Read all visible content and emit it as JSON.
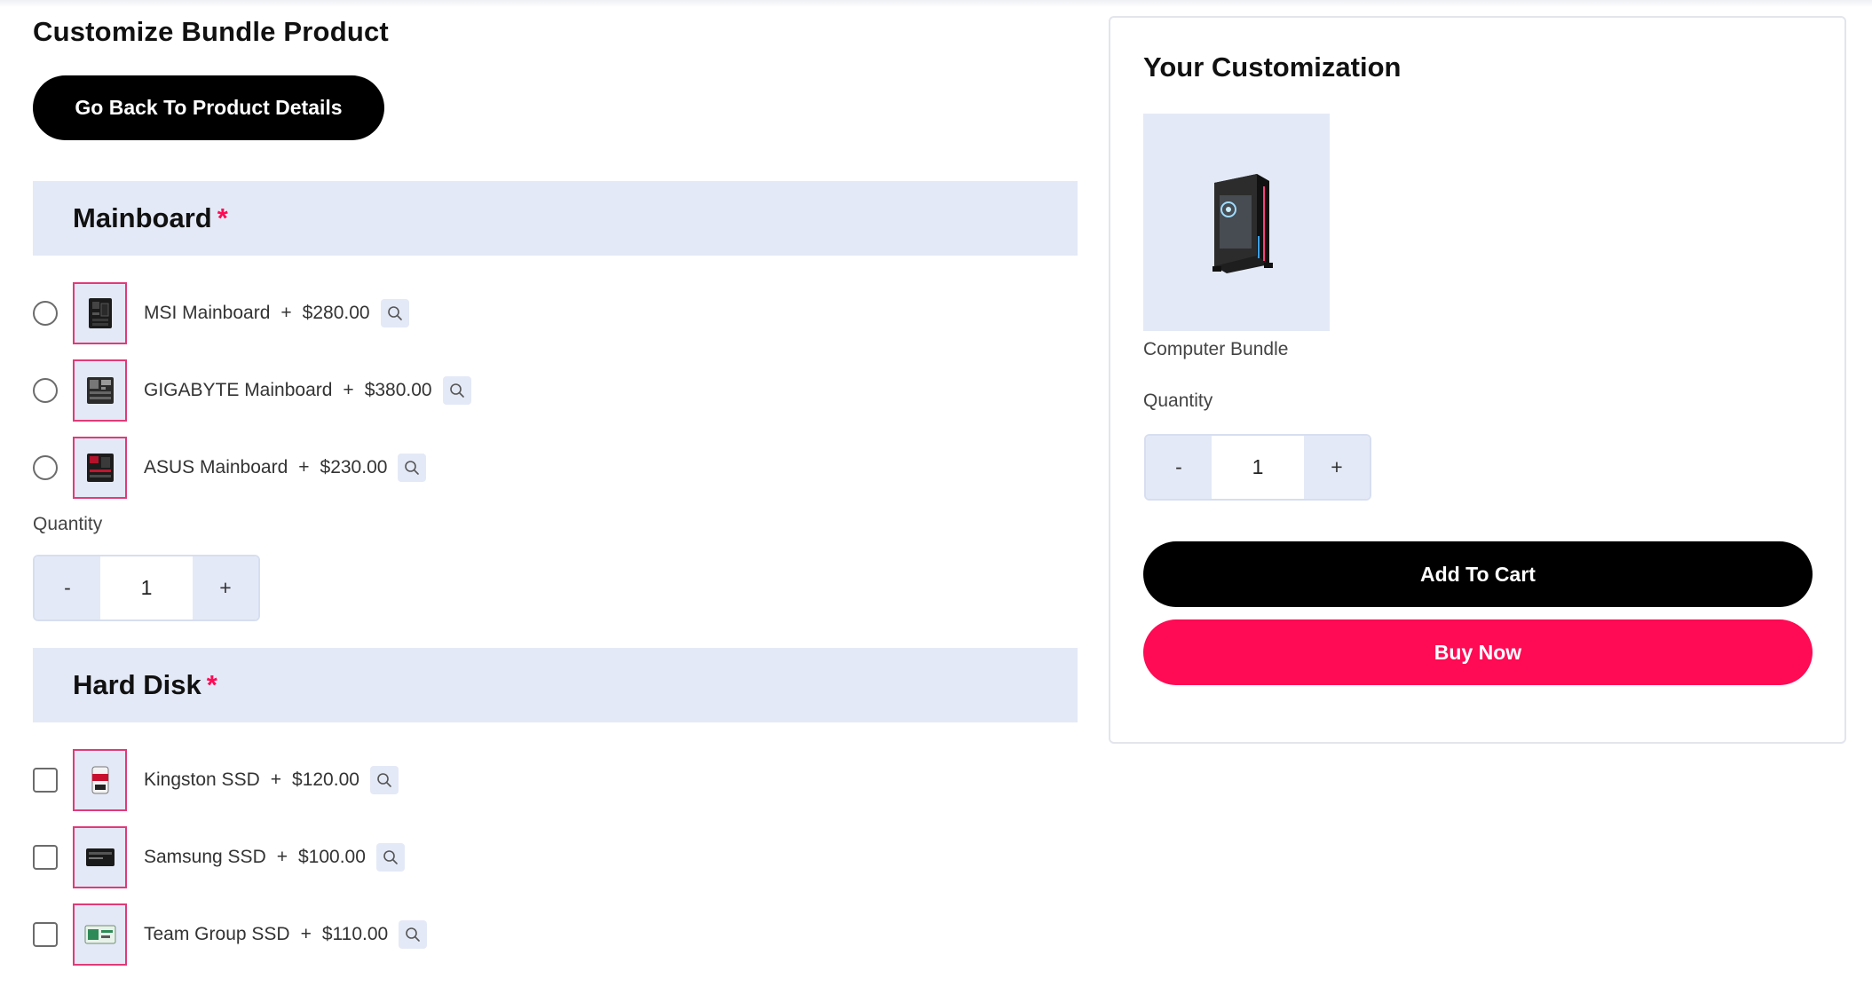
{
  "page": {
    "title": "Customize Bundle Product",
    "back_button": "Go Back To Product Details"
  },
  "mainboard": {
    "title": "Mainboard",
    "required_mark": "*",
    "input_type": "radio",
    "options": [
      {
        "name": "MSI Mainboard",
        "plus": "+",
        "price": "$280.00",
        "thumb_icon": "mainboard-thumb-icon"
      },
      {
        "name": "GIGABYTE Mainboard",
        "plus": "+",
        "price": "$380.00",
        "thumb_icon": "mainboard-thumb-icon"
      },
      {
        "name": "ASUS Mainboard",
        "plus": "+",
        "price": "$230.00",
        "thumb_icon": "mainboard-thumb-icon"
      }
    ],
    "quantity_label": "Quantity",
    "quantity": "1",
    "minus": "-",
    "plus": "+"
  },
  "harddisk": {
    "title": "Hard Disk",
    "required_mark": "*",
    "input_type": "checkbox",
    "options": [
      {
        "name": "Kingston SSD",
        "plus": "+",
        "price": "$120.00",
        "thumb_icon": "ssd-thumb-icon"
      },
      {
        "name": "Samsung SSD",
        "plus": "+",
        "price": "$100.00",
        "thumb_icon": "ssd-thumb-icon"
      },
      {
        "name": "Team Group SSD",
        "plus": "+",
        "price": "$110.00",
        "thumb_icon": "ssd-thumb-icon"
      }
    ]
  },
  "customization": {
    "title": "Your Customization",
    "product_name": "Computer Bundle",
    "product_icon": "pc-case-icon",
    "quantity_label": "Quantity",
    "quantity": "1",
    "minus": "-",
    "plus": "+",
    "add_to_cart": "Add To Cart",
    "buy_now": "Buy Now"
  },
  "colors": {
    "accent": "#ff0a54",
    "section_bg": "#e4e9f7",
    "primary_button": "#000000",
    "thumb_border": "#e03a79"
  }
}
